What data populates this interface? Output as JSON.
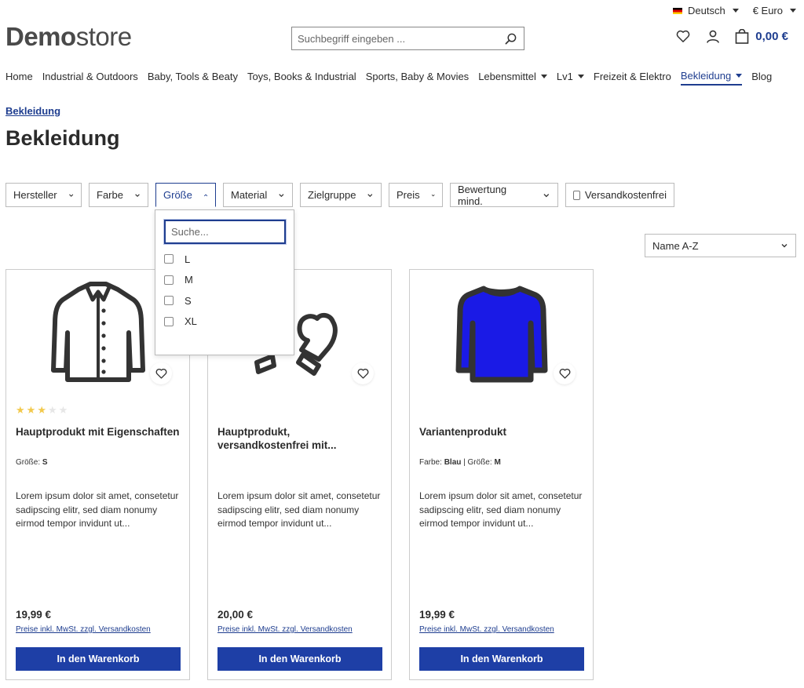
{
  "topbar": {
    "language": "Deutsch",
    "currency": "€ Euro"
  },
  "header": {
    "logo_bold": "Demo",
    "logo_light": "store",
    "search_placeholder": "Suchbegriff eingeben ...",
    "cart_total": "0,00 €"
  },
  "nav": [
    {
      "label": "Home",
      "dropdown": false,
      "active": false
    },
    {
      "label": "Industrial & Outdoors",
      "dropdown": false,
      "active": false
    },
    {
      "label": "Baby, Tools & Beaty",
      "dropdown": false,
      "active": false
    },
    {
      "label": "Toys, Books & Industrial",
      "dropdown": false,
      "active": false
    },
    {
      "label": "Sports, Baby & Movies",
      "dropdown": false,
      "active": false
    },
    {
      "label": "Lebensmittel",
      "dropdown": true,
      "active": false
    },
    {
      "label": "Lv1",
      "dropdown": true,
      "active": false
    },
    {
      "label": "Freizeit & Elektro",
      "dropdown": false,
      "active": false
    },
    {
      "label": "Bekleidung",
      "dropdown": true,
      "active": true
    },
    {
      "label": "Blog",
      "dropdown": false,
      "active": false
    }
  ],
  "breadcrumb": "Bekleidung",
  "page_title": "Bekleidung",
  "filters": {
    "hersteller": "Hersteller",
    "farbe": "Farbe",
    "groesse": "Größe",
    "material": "Material",
    "zielgruppe": "Zielgruppe",
    "preis": "Preis",
    "bewertung": "Bewertung mind.",
    "versandkostenfrei": "Versandkostenfrei"
  },
  "size_dropdown": {
    "search_placeholder": "Suche...",
    "options": [
      "L",
      "M",
      "S",
      "XL"
    ]
  },
  "sort": {
    "selected": "Name A-Z"
  },
  "products": [
    {
      "name": "Hauptprodukt mit Eigenschaften",
      "rating": 3,
      "variant": [
        {
          "label": "Größe:",
          "value": "S"
        }
      ],
      "description": "Lorem ipsum dolor sit amet, consetetur sadipscing elitr, sed diam nonumy eirmod tempor invidunt ut...",
      "price": "19,99 €",
      "tax_note": "Preise inkl. MwSt. zzgl. Versandkosten",
      "buy_label": "In den Warenkorb",
      "image_icon": "jacket-icon"
    },
    {
      "name": "Hauptprodukt, versandkostenfrei mit...",
      "rating": 0,
      "variant": [],
      "description": "Lorem ipsum dolor sit amet, consetetur sadipscing elitr, sed diam nonumy eirmod tempor invidunt ut...",
      "price": "20,00 €",
      "tax_note": "Preise inkl. MwSt. zzgl. Versandkosten",
      "buy_label": "In den Warenkorb",
      "image_icon": "gloves-icon"
    },
    {
      "name": "Variantenprodukt",
      "rating": 0,
      "variant": [
        {
          "label": "Farbe:",
          "value": "Blau"
        },
        {
          "label": "Größe:",
          "value": "M"
        }
      ],
      "description": "Lorem ipsum dolor sit amet, consetetur sadipscing elitr, sed diam nonumy eirmod tempor invidunt ut...",
      "price": "19,99 €",
      "tax_note": "Preise inkl. MwSt. zzgl. Versandkosten",
      "buy_label": "In den Warenkorb",
      "image_icon": "sweater-icon"
    }
  ],
  "colors": {
    "brand": "#1e3d8f",
    "button": "#1e3fa6",
    "star": "#f2c94c",
    "sweater": "#1a1ae6"
  }
}
